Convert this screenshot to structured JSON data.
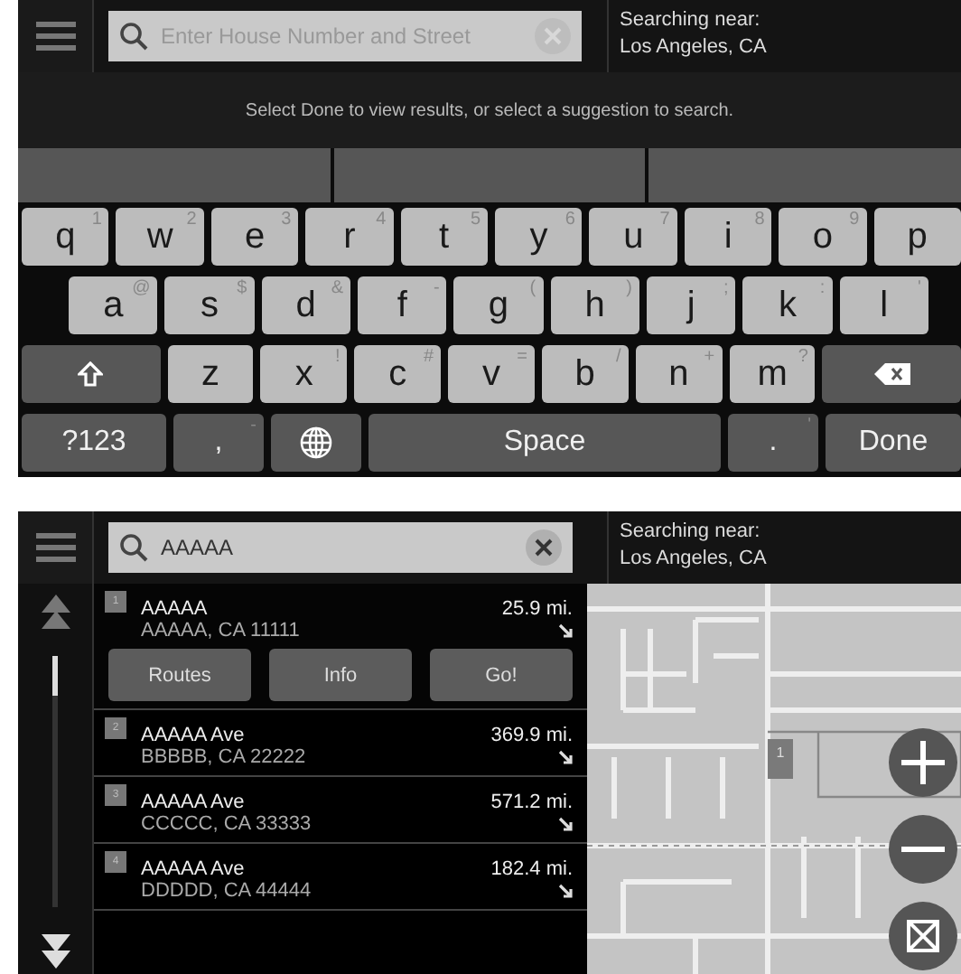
{
  "keyboard_screen": {
    "search": {
      "placeholder": "Enter House Number and Street"
    },
    "searching_near": {
      "label": "Searching near:",
      "place": "Los Angeles, CA"
    },
    "message": "Select Done to view results, or select a suggestion to search.",
    "keyboard": {
      "rows": [
        {
          "keys": [
            {
              "kind": "letter",
              "label": "q",
              "sup": "1"
            },
            {
              "kind": "letter",
              "label": "w",
              "sup": "2"
            },
            {
              "kind": "letter",
              "label": "e",
              "sup": "3"
            },
            {
              "kind": "letter",
              "label": "r",
              "sup": "4"
            },
            {
              "kind": "letter",
              "label": "t",
              "sup": "5"
            },
            {
              "kind": "letter",
              "label": "y",
              "sup": "6"
            },
            {
              "kind": "letter",
              "label": "u",
              "sup": "7"
            },
            {
              "kind": "letter",
              "label": "i",
              "sup": "8"
            },
            {
              "kind": "letter",
              "label": "o",
              "sup": "9"
            },
            {
              "kind": "letter",
              "label": "p"
            }
          ]
        },
        {
          "keys": [
            {
              "kind": "letter",
              "label": "a",
              "sup": "@"
            },
            {
              "kind": "letter",
              "label": "s",
              "sup": "$"
            },
            {
              "kind": "letter",
              "label": "d",
              "sup": "&"
            },
            {
              "kind": "letter",
              "label": "f",
              "sup": "-"
            },
            {
              "kind": "letter",
              "label": "g",
              "sup": "("
            },
            {
              "kind": "letter",
              "label": "h",
              "sup": ")"
            },
            {
              "kind": "letter",
              "label": "j",
              "sup": ";"
            },
            {
              "kind": "letter",
              "label": "k",
              "sup": ":"
            },
            {
              "kind": "letter",
              "label": "l",
              "sup": "'"
            }
          ]
        },
        {
          "keys": [
            {
              "kind": "shift"
            },
            {
              "kind": "letter",
              "label": "z"
            },
            {
              "kind": "letter",
              "label": "x",
              "sup": "!"
            },
            {
              "kind": "letter",
              "label": "c",
              "sup": "#"
            },
            {
              "kind": "letter",
              "label": "v",
              "sup": "="
            },
            {
              "kind": "letter",
              "label": "b",
              "sup": "/"
            },
            {
              "kind": "letter",
              "label": "n",
              "sup": "+"
            },
            {
              "kind": "letter",
              "label": "m",
              "sup": "?"
            },
            {
              "kind": "backspace"
            }
          ]
        },
        {
          "keys": [
            {
              "kind": "mode",
              "label": "?123"
            },
            {
              "kind": "punct",
              "label": ",",
              "sup": "-"
            },
            {
              "kind": "globe"
            },
            {
              "kind": "space",
              "label": "Space"
            },
            {
              "kind": "punct",
              "label": ".",
              "sup": "'"
            },
            {
              "kind": "done",
              "label": "Done"
            }
          ]
        }
      ]
    }
  },
  "results_screen": {
    "search": {
      "value": "AAAAA"
    },
    "searching_near": {
      "label": "Searching near:",
      "place": "Los Angeles, CA"
    },
    "results": [
      {
        "number": "1",
        "name": "AAAAA",
        "address": "AAAAA, CA 11111",
        "distance": "25.9 mi.",
        "expanded": true,
        "actions": [
          "Routes",
          "Info",
          "Go!"
        ]
      },
      {
        "number": "2",
        "name": "AAAAA Ave",
        "address": "BBBBB, CA 22222",
        "distance": "369.9 mi.",
        "expanded": false
      },
      {
        "number": "3",
        "name": "AAAAA Ave",
        "address": "CCCCC, CA 33333",
        "distance": "571.2 mi.",
        "expanded": false
      },
      {
        "number": "4",
        "name": "AAAAA Ave",
        "address": "DDDDD, CA 44444",
        "distance": "182.4 mi.",
        "expanded": false
      }
    ],
    "map": {
      "pin_number": "1"
    }
  }
}
